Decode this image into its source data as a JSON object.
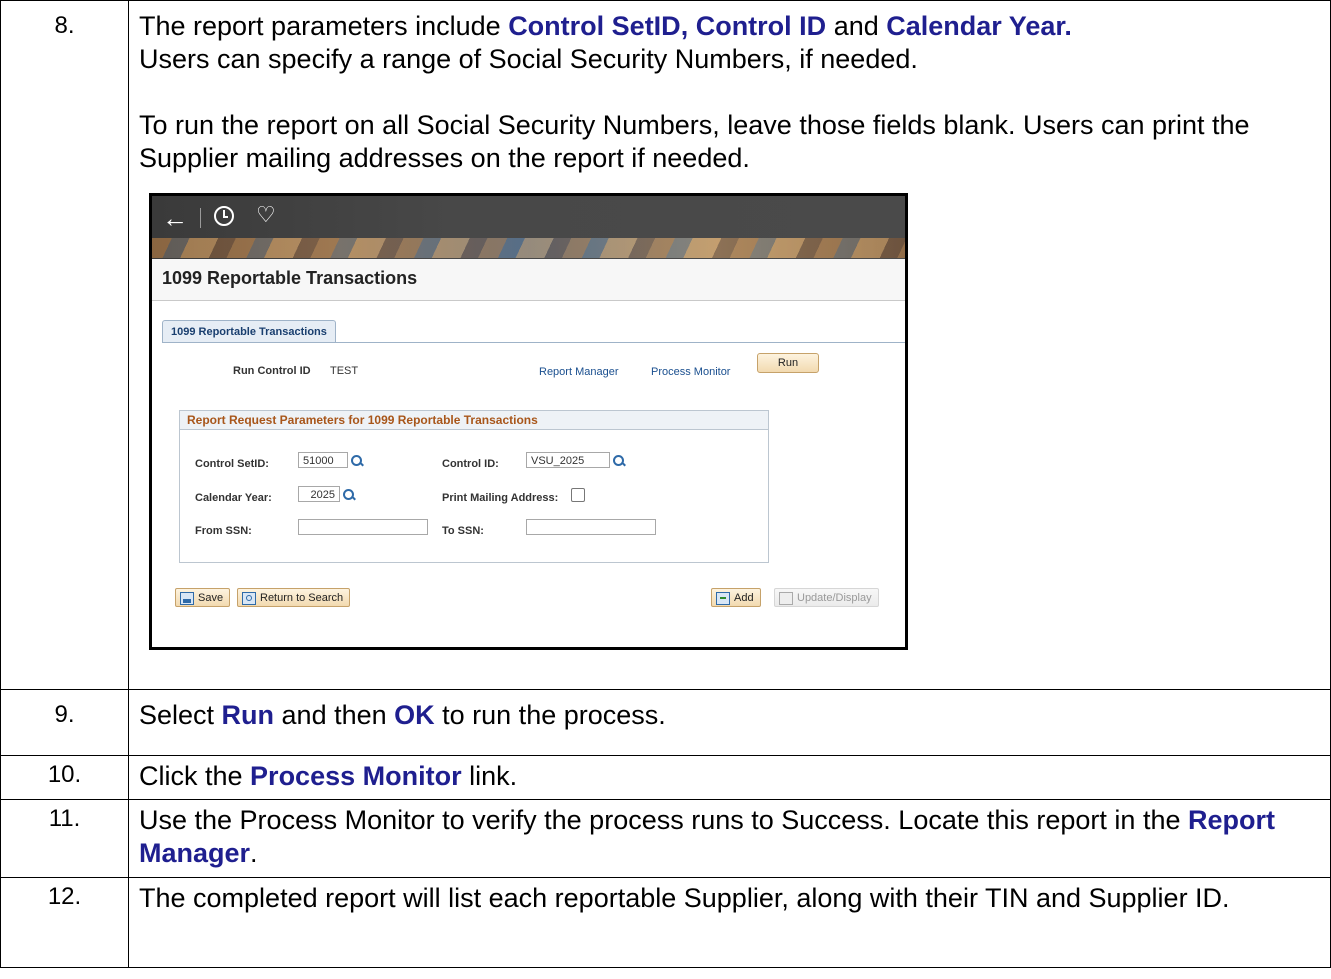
{
  "steps": [
    {
      "num": "8.",
      "p1_a": "The report parameters include ",
      "p1_kw1": "Control SetID",
      "p1_b": ", ",
      "p1_kw2": "Control ID",
      "p1_c": " and ",
      "p1_kw3": "Calendar Year",
      "p1_d": ".",
      "p1_line2": "Users can specify a range of Social Security Numbers, if needed.",
      "p2": "To run the report on all Social Security Numbers, leave those fields blank. Users can print the Supplier mailing addresses on the report if needed."
    },
    {
      "num": "9.",
      "a": "Select ",
      "kw1": "Run",
      "b": " and then ",
      "kw2": "OK",
      "c": " to run the process."
    },
    {
      "num": "10.",
      "a": "Click the ",
      "kw1": "Process Monitor",
      "b": " link."
    },
    {
      "num": "11.",
      "a": "Use the Process Monitor to verify the process runs to Success. Locate this report in the ",
      "kw1": "Report Manager",
      "b": "."
    },
    {
      "num": "12.",
      "a": "The completed report will list each reportable Supplier, along with their TIN and Supplier ID."
    }
  ],
  "screenshot": {
    "nav": {
      "back_icon": "arrow-left-icon",
      "history_icon": "clock-icon",
      "favorite_icon": "heart-icon"
    },
    "page_title": "1099 Reportable Transactions",
    "tab_label": "1099 Reportable Transactions",
    "run_control_label": "Run Control ID",
    "run_control_value": "TEST",
    "report_manager_link": "Report Manager",
    "process_monitor_link": "Process Monitor",
    "run_button": "Run",
    "group_title": "Report Request Parameters for 1099 Reportable Transactions",
    "fields": {
      "control_setid_label": "Control SetID:",
      "control_setid_value": "51000",
      "control_id_label": "Control ID:",
      "control_id_value": "VSU_2025",
      "calendar_year_label": "Calendar Year:",
      "calendar_year_value": "2025",
      "print_mailing_label": "Print Mailing Address:",
      "print_mailing_checked": false,
      "from_ssn_label": "From SSN:",
      "from_ssn_value": "",
      "to_ssn_label": "To SSN:",
      "to_ssn_value": ""
    },
    "toolbar": {
      "save": "Save",
      "return_to_search": "Return to Search",
      "add": "Add",
      "update_display": "Update/Display"
    }
  }
}
